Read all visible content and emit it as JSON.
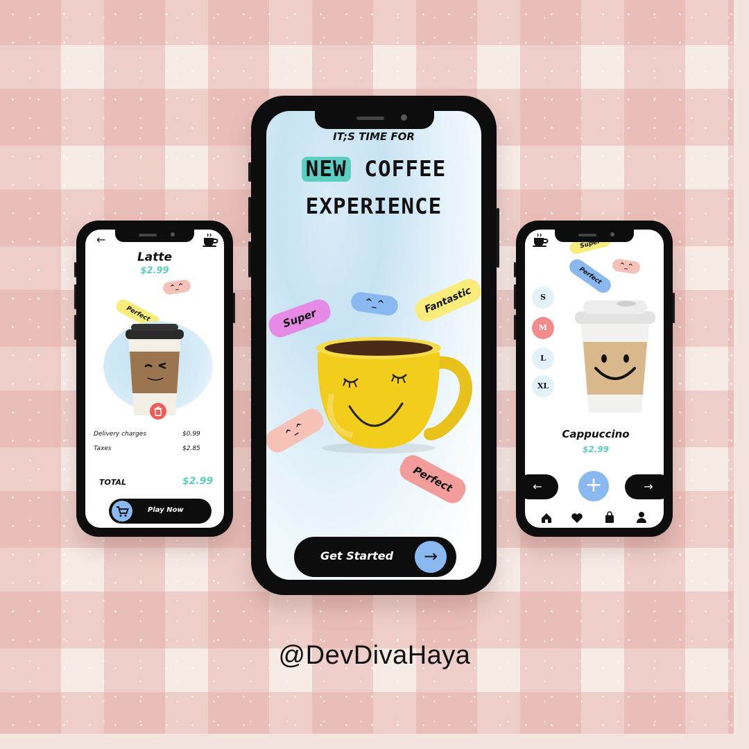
{
  "center": {
    "eyebrow": "IT;S TIME FOR",
    "headline_highlight": "NEW",
    "headline_rest": "COFFEE",
    "headline_line2": "EXPERIENCE",
    "tags": {
      "super": "Super",
      "face": "^_^",
      "fantastic": "Fantastic",
      "face2": "^_^",
      "perfect": "Perfect"
    },
    "cta_label": "Get Started",
    "cta_arrow": "→"
  },
  "left": {
    "back": "←",
    "title": "Latte",
    "price": "$2.99",
    "tags": {
      "face": "^_^",
      "perfect": "Perfect"
    },
    "rows": [
      {
        "label": "Delivery charges",
        "value": "$0.99"
      },
      {
        "label": "Taxes",
        "value": "$2.85"
      }
    ],
    "total_label": "TOTAL",
    "total_value": "$2.99",
    "button_label": "Play Now"
  },
  "right": {
    "tags": {
      "super": "Super",
      "perfect": "Perfect",
      "face": "^_^"
    },
    "sizes": [
      "S",
      "M",
      "L",
      "XL"
    ],
    "name": "Cappuccino",
    "price": "$2.99",
    "prev": "←",
    "add": "+",
    "next": "→"
  },
  "handle": "@DevDivaHaya",
  "colors": {
    "accent_teal": "#5ccdc1",
    "accent_blue": "#8ab8f0",
    "pink": "#f28b8b",
    "mug_yellow": "#f2cd1c"
  }
}
